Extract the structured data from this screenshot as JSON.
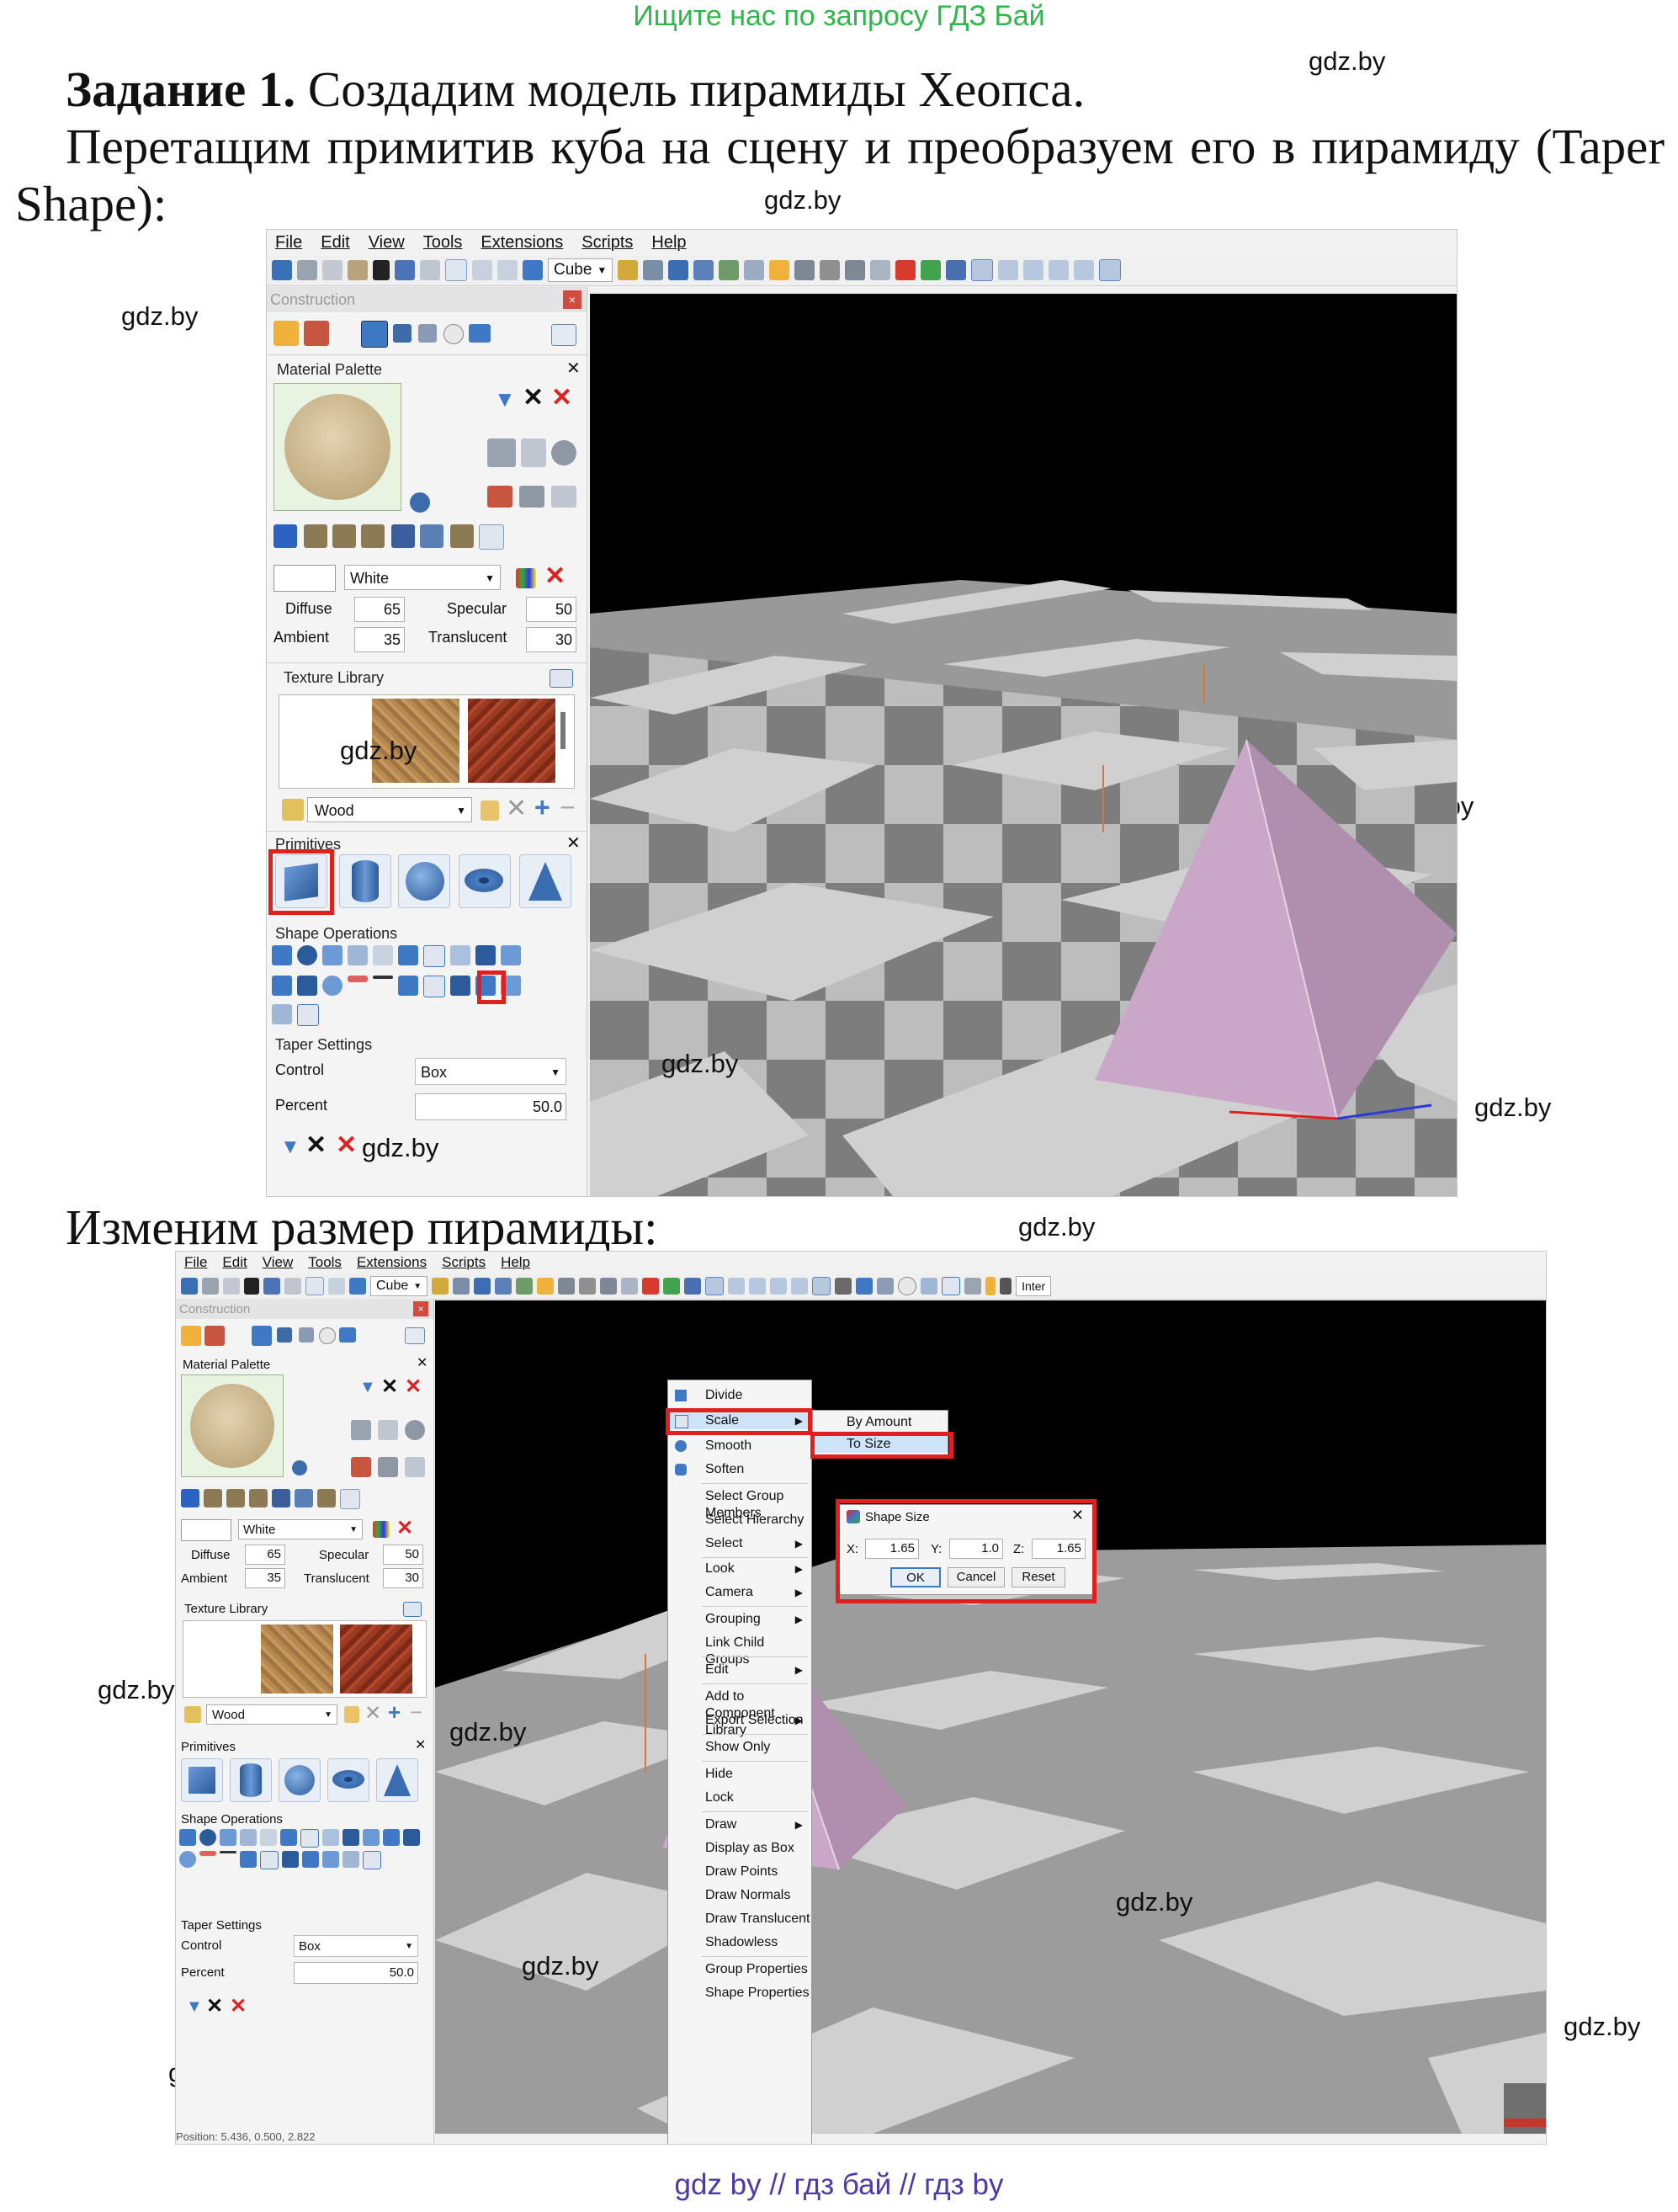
{
  "header_banner": "Ищите нас по запросу ГДЗ Бай",
  "watermark": "gdz.by",
  "task": {
    "label": "Задание 1.",
    "text": " Создадим модель пирамиды Хеопса."
  },
  "para1_line1": "Перетащим примитив куба на сцену и преобразуем его в пирамиду (Taper",
  "para1_line2": "Shape):",
  "para2": "Изменим размер пирамиды:",
  "footer": "gdz by  //  гдз бай  //  гдз by",
  "colors": {
    "highlight_red": "#e0201e",
    "pyramid": "#caa7c8",
    "banner_green": "#2fb84a",
    "footer_purple": "#4b3aa8"
  },
  "app": {
    "menu": [
      "File",
      "Edit",
      "View",
      "Tools",
      "Extensions",
      "Scripts",
      "Help"
    ],
    "shape_select": "Cube",
    "toolbar_right_text": "Inter",
    "construction_title": "Construction",
    "material_palette_title": "Material Palette",
    "material_color": "White",
    "diffuse_label": "Diffuse",
    "diffuse_value": "65",
    "specular_label": "Specular",
    "specular_value": "50",
    "ambient_label": "Ambient",
    "ambient_value": "35",
    "translucent_label": "Translucent",
    "translucent_value": "30",
    "texture_library_title": "Texture Library",
    "texture_select": "Wood",
    "primitives_title": "Primitives",
    "primitives": [
      "cube-icon",
      "cylinder-icon",
      "sphere-icon",
      "torus-icon",
      "cone-icon"
    ],
    "shape_operations_title": "Shape Operations",
    "taper_settings_title": "Taper Settings",
    "control_label": "Control",
    "control_value": "Box",
    "percent_label": "Percent",
    "percent_value": "50.0"
  },
  "context_menu": {
    "items": [
      "Divide",
      "Scale",
      "Smooth",
      "Soften",
      "Select Group Members",
      "Select Hierarchy",
      "Select",
      "Look",
      "Camera",
      "Grouping",
      "Link Child Groups",
      "Edit",
      "Add to Component Library",
      "Export Selection",
      "Show Only",
      "Hide",
      "Lock",
      "Draw",
      "Display as Box",
      "Draw Points",
      "Draw Normals",
      "Draw Translucent",
      "Shadowless",
      "Group Properties",
      "Shape Properties"
    ],
    "submenu": [
      "By Amount",
      "To Size"
    ]
  },
  "shape_size_dialog": {
    "title": "Shape Size",
    "x_label": "X:",
    "x_value": "1.65",
    "y_label": "Y:",
    "y_value": "1.0",
    "z_label": "Z:",
    "z_value": "1.65",
    "ok": "OK",
    "cancel": "Cancel",
    "reset": "Reset"
  },
  "status_bar": "Position: 5.436, 0.500, 2.822"
}
